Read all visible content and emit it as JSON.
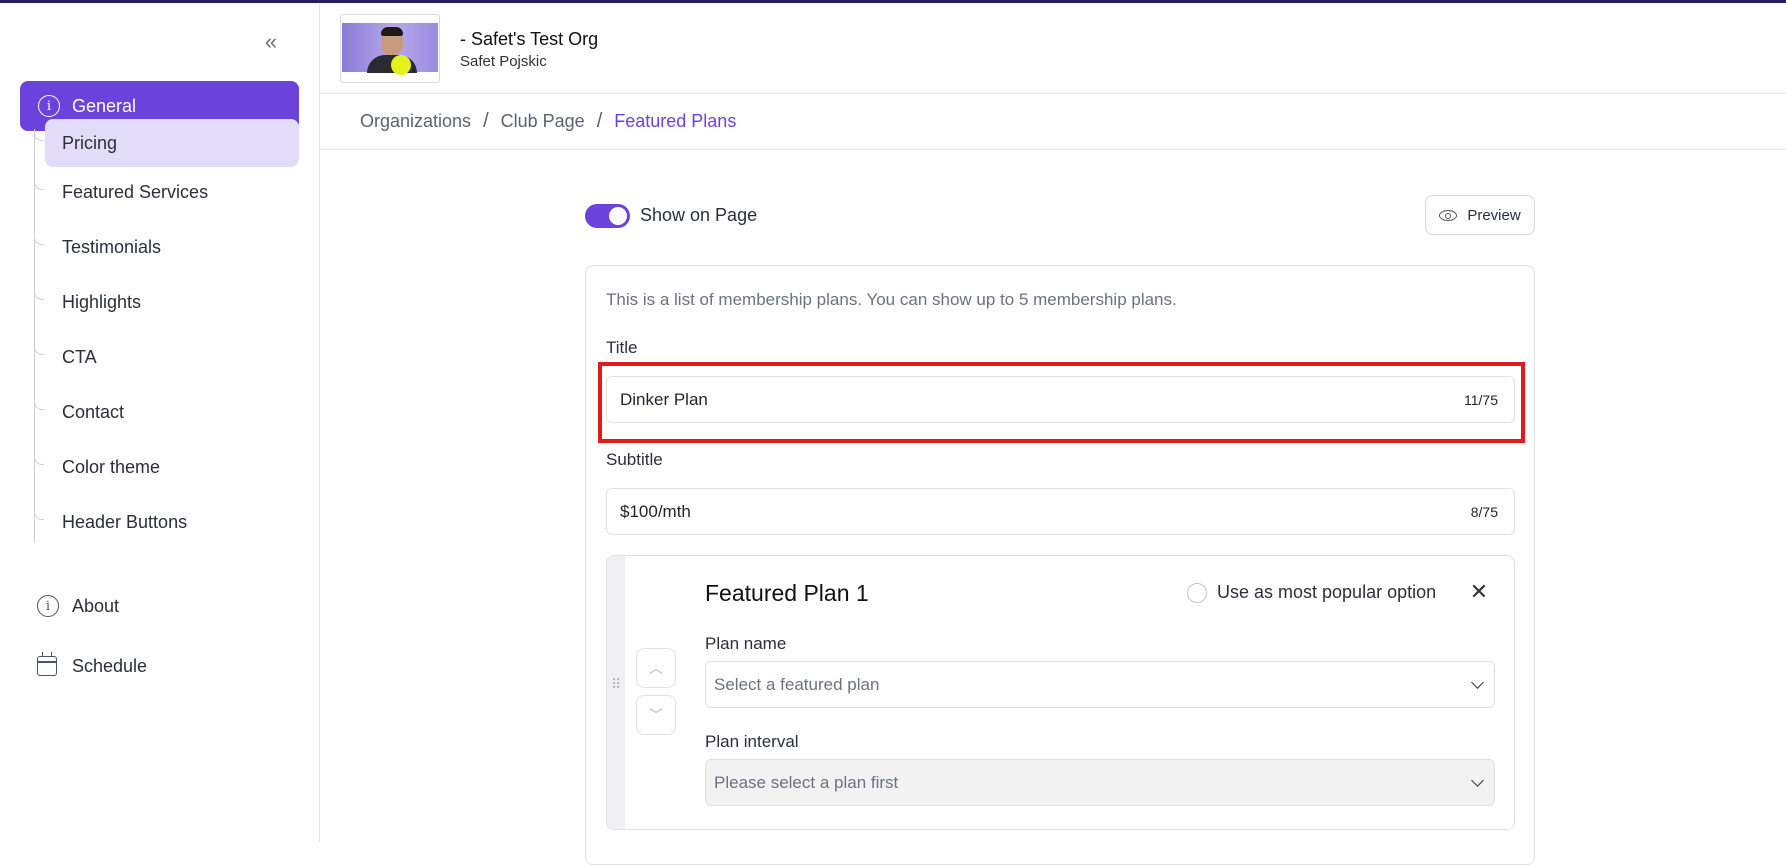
{
  "header": {
    "org_name": "- Safet's Test Org",
    "owner_name": "Safet Pojskic"
  },
  "breadcrumb": {
    "items": [
      "Organizations",
      "Club Page",
      "Featured Plans"
    ],
    "separator": "/"
  },
  "sidebar": {
    "collapse_glyph": "«",
    "general_label": "General",
    "sub_items": [
      {
        "label": "Pricing",
        "active": true
      },
      {
        "label": "Featured Services",
        "active": false
      },
      {
        "label": "Testimonials",
        "active": false
      },
      {
        "label": "Highlights",
        "active": false
      },
      {
        "label": "CTA",
        "active": false
      },
      {
        "label": "Contact",
        "active": false
      },
      {
        "label": "Color theme",
        "active": false
      },
      {
        "label": "Header Buttons",
        "active": false
      }
    ],
    "about_label": "About",
    "schedule_label": "Schedule"
  },
  "main": {
    "show_on_page_label": "Show on Page",
    "show_on_page_enabled": true,
    "preview_label": "Preview",
    "description": "This is a list of membership plans. You can show up to 5 membership plans.",
    "title_label": "Title",
    "title_value": "Dinker Plan",
    "title_counter": "11/75",
    "subtitle_label": "Subtitle",
    "subtitle_value": "$100/mth",
    "subtitle_counter": "8/75",
    "plan": {
      "title": "Featured Plan 1",
      "popular_label": "Use as most popular option",
      "close_glyph": "✕",
      "plan_name_label": "Plan name",
      "plan_name_placeholder": "Select a featured plan",
      "plan_interval_label": "Plan interval",
      "plan_interval_placeholder": "Please select a plan first"
    }
  },
  "colors": {
    "accent": "#6c42dd",
    "accent_light": "#e2dcf8",
    "highlight_box": "#e01b1b"
  }
}
